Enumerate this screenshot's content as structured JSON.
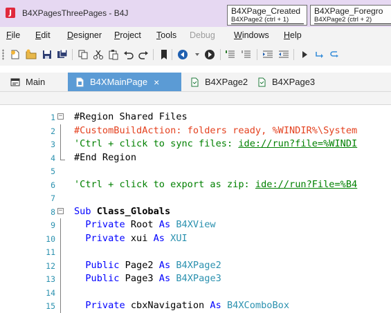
{
  "window": {
    "logo_letter": "J",
    "title": "B4XPagesThreePages - B4J"
  },
  "tab_popups": [
    {
      "title": "B4XPage_Created",
      "subtitle": "B4XPage2  (ctrl + 1)"
    },
    {
      "title": "B4XPage_Foregro",
      "subtitle": "B4XPage2  (ctrl + 2)"
    }
  ],
  "menu": [
    {
      "label": "File",
      "u": "F",
      "rest": "ile",
      "disabled": false
    },
    {
      "label": "Edit",
      "u": "E",
      "rest": "dit",
      "disabled": false
    },
    {
      "label": "Designer",
      "u": "D",
      "rest": "esigner",
      "disabled": false
    },
    {
      "label": "Project",
      "u": "P",
      "rest": "roject",
      "disabled": false
    },
    {
      "label": "Tools",
      "u": "T",
      "rest": "ools",
      "disabled": false
    },
    {
      "label": "Debug",
      "u": "",
      "rest": "Debug",
      "disabled": true
    },
    {
      "label": "Windows",
      "u": "W",
      "rest": "indows",
      "disabled": false
    },
    {
      "label": "Help",
      "u": "H",
      "rest": "elp",
      "disabled": false
    }
  ],
  "toolbar_icons": [
    "new-file-icon",
    "open-file-icon",
    "save-icon",
    "save-all-icon",
    "copy-icon",
    "cut-icon",
    "paste-icon",
    "undo-icon",
    "redo-icon",
    "bookmark-icon",
    "navigate-back-icon",
    "navigate-dropdown-icon",
    "navigate-forward-icon",
    "comment-icon",
    "uncomment-icon",
    "indent-icon",
    "outdent-icon",
    "run-icon",
    "debug-icon",
    "compile-icon"
  ],
  "tabs": [
    {
      "label": "Main",
      "active": false,
      "icon": "module-icon"
    },
    {
      "label": "B4XMainPage",
      "active": true,
      "icon": "class-icon",
      "close": "×"
    },
    {
      "label": "B4XPage2",
      "active": false,
      "icon": "class-icon"
    },
    {
      "label": "B4XPage3",
      "active": false,
      "icon": "class-icon"
    }
  ],
  "code_lines": [
    {
      "n": "1",
      "fold": "region-start",
      "parts": [
        {
          "t": "#Region Shared Files",
          "c": "c-region"
        }
      ]
    },
    {
      "n": "2",
      "fold": "line",
      "parts": [
        {
          "t": "#CustomBuildAction:",
          "c": "c-directive"
        },
        {
          "t": " folders ready, %WINDIR%\\System",
          "c": "c-directive"
        }
      ]
    },
    {
      "n": "3",
      "fold": "line",
      "parts": [
        {
          "t": "'Ctrl + click to sync files: ",
          "c": "c-comment"
        },
        {
          "t": "ide://run?file=%WINDI",
          "c": "c-link"
        }
      ]
    },
    {
      "n": "4",
      "fold": "end",
      "parts": [
        {
          "t": "#End Region",
          "c": "c-region"
        }
      ]
    },
    {
      "n": "5",
      "fold": "",
      "parts": []
    },
    {
      "n": "6",
      "fold": "",
      "parts": [
        {
          "t": "'Ctrl + click to export as zip: ",
          "c": "c-comment"
        },
        {
          "t": "ide://run?File=%B4",
          "c": "c-link"
        }
      ]
    },
    {
      "n": "7",
      "fold": "",
      "parts": []
    },
    {
      "n": "8",
      "fold": "sub-start",
      "parts": [
        {
          "t": "Sub ",
          "c": "c-kw"
        },
        {
          "t": "Class_Globals",
          "c": "c-bold"
        }
      ]
    },
    {
      "n": "9",
      "fold": "line",
      "parts": [
        {
          "t": "  Private ",
          "c": "c-kw"
        },
        {
          "t": "Root ",
          "c": ""
        },
        {
          "t": "As ",
          "c": "c-kw"
        },
        {
          "t": "B4XView",
          "c": "c-type"
        }
      ]
    },
    {
      "n": "10",
      "fold": "line",
      "parts": [
        {
          "t": "  Private ",
          "c": "c-kw"
        },
        {
          "t": "xui ",
          "c": ""
        },
        {
          "t": "As ",
          "c": "c-kw"
        },
        {
          "t": "XUI",
          "c": "c-type"
        }
      ]
    },
    {
      "n": "11",
      "fold": "line",
      "parts": []
    },
    {
      "n": "12",
      "fold": "line",
      "parts": [
        {
          "t": "  Public ",
          "c": "c-kw"
        },
        {
          "t": "Page2 ",
          "c": ""
        },
        {
          "t": "As ",
          "c": "c-kw"
        },
        {
          "t": "B4XPage2",
          "c": "c-type"
        }
      ]
    },
    {
      "n": "13",
      "fold": "line",
      "parts": [
        {
          "t": "  Public ",
          "c": "c-kw"
        },
        {
          "t": "Page3 ",
          "c": ""
        },
        {
          "t": "As ",
          "c": "c-kw"
        },
        {
          "t": "B4XPage3",
          "c": "c-type"
        }
      ]
    },
    {
      "n": "14",
      "fold": "line",
      "parts": []
    },
    {
      "n": "15",
      "fold": "line",
      "parts": [
        {
          "t": "  Private ",
          "c": "c-kw"
        },
        {
          "t": "cbxNavigation ",
          "c": ""
        },
        {
          "t": "As ",
          "c": "c-kw"
        },
        {
          "t": "B4XComboBox",
          "c": "c-type"
        }
      ]
    }
  ]
}
